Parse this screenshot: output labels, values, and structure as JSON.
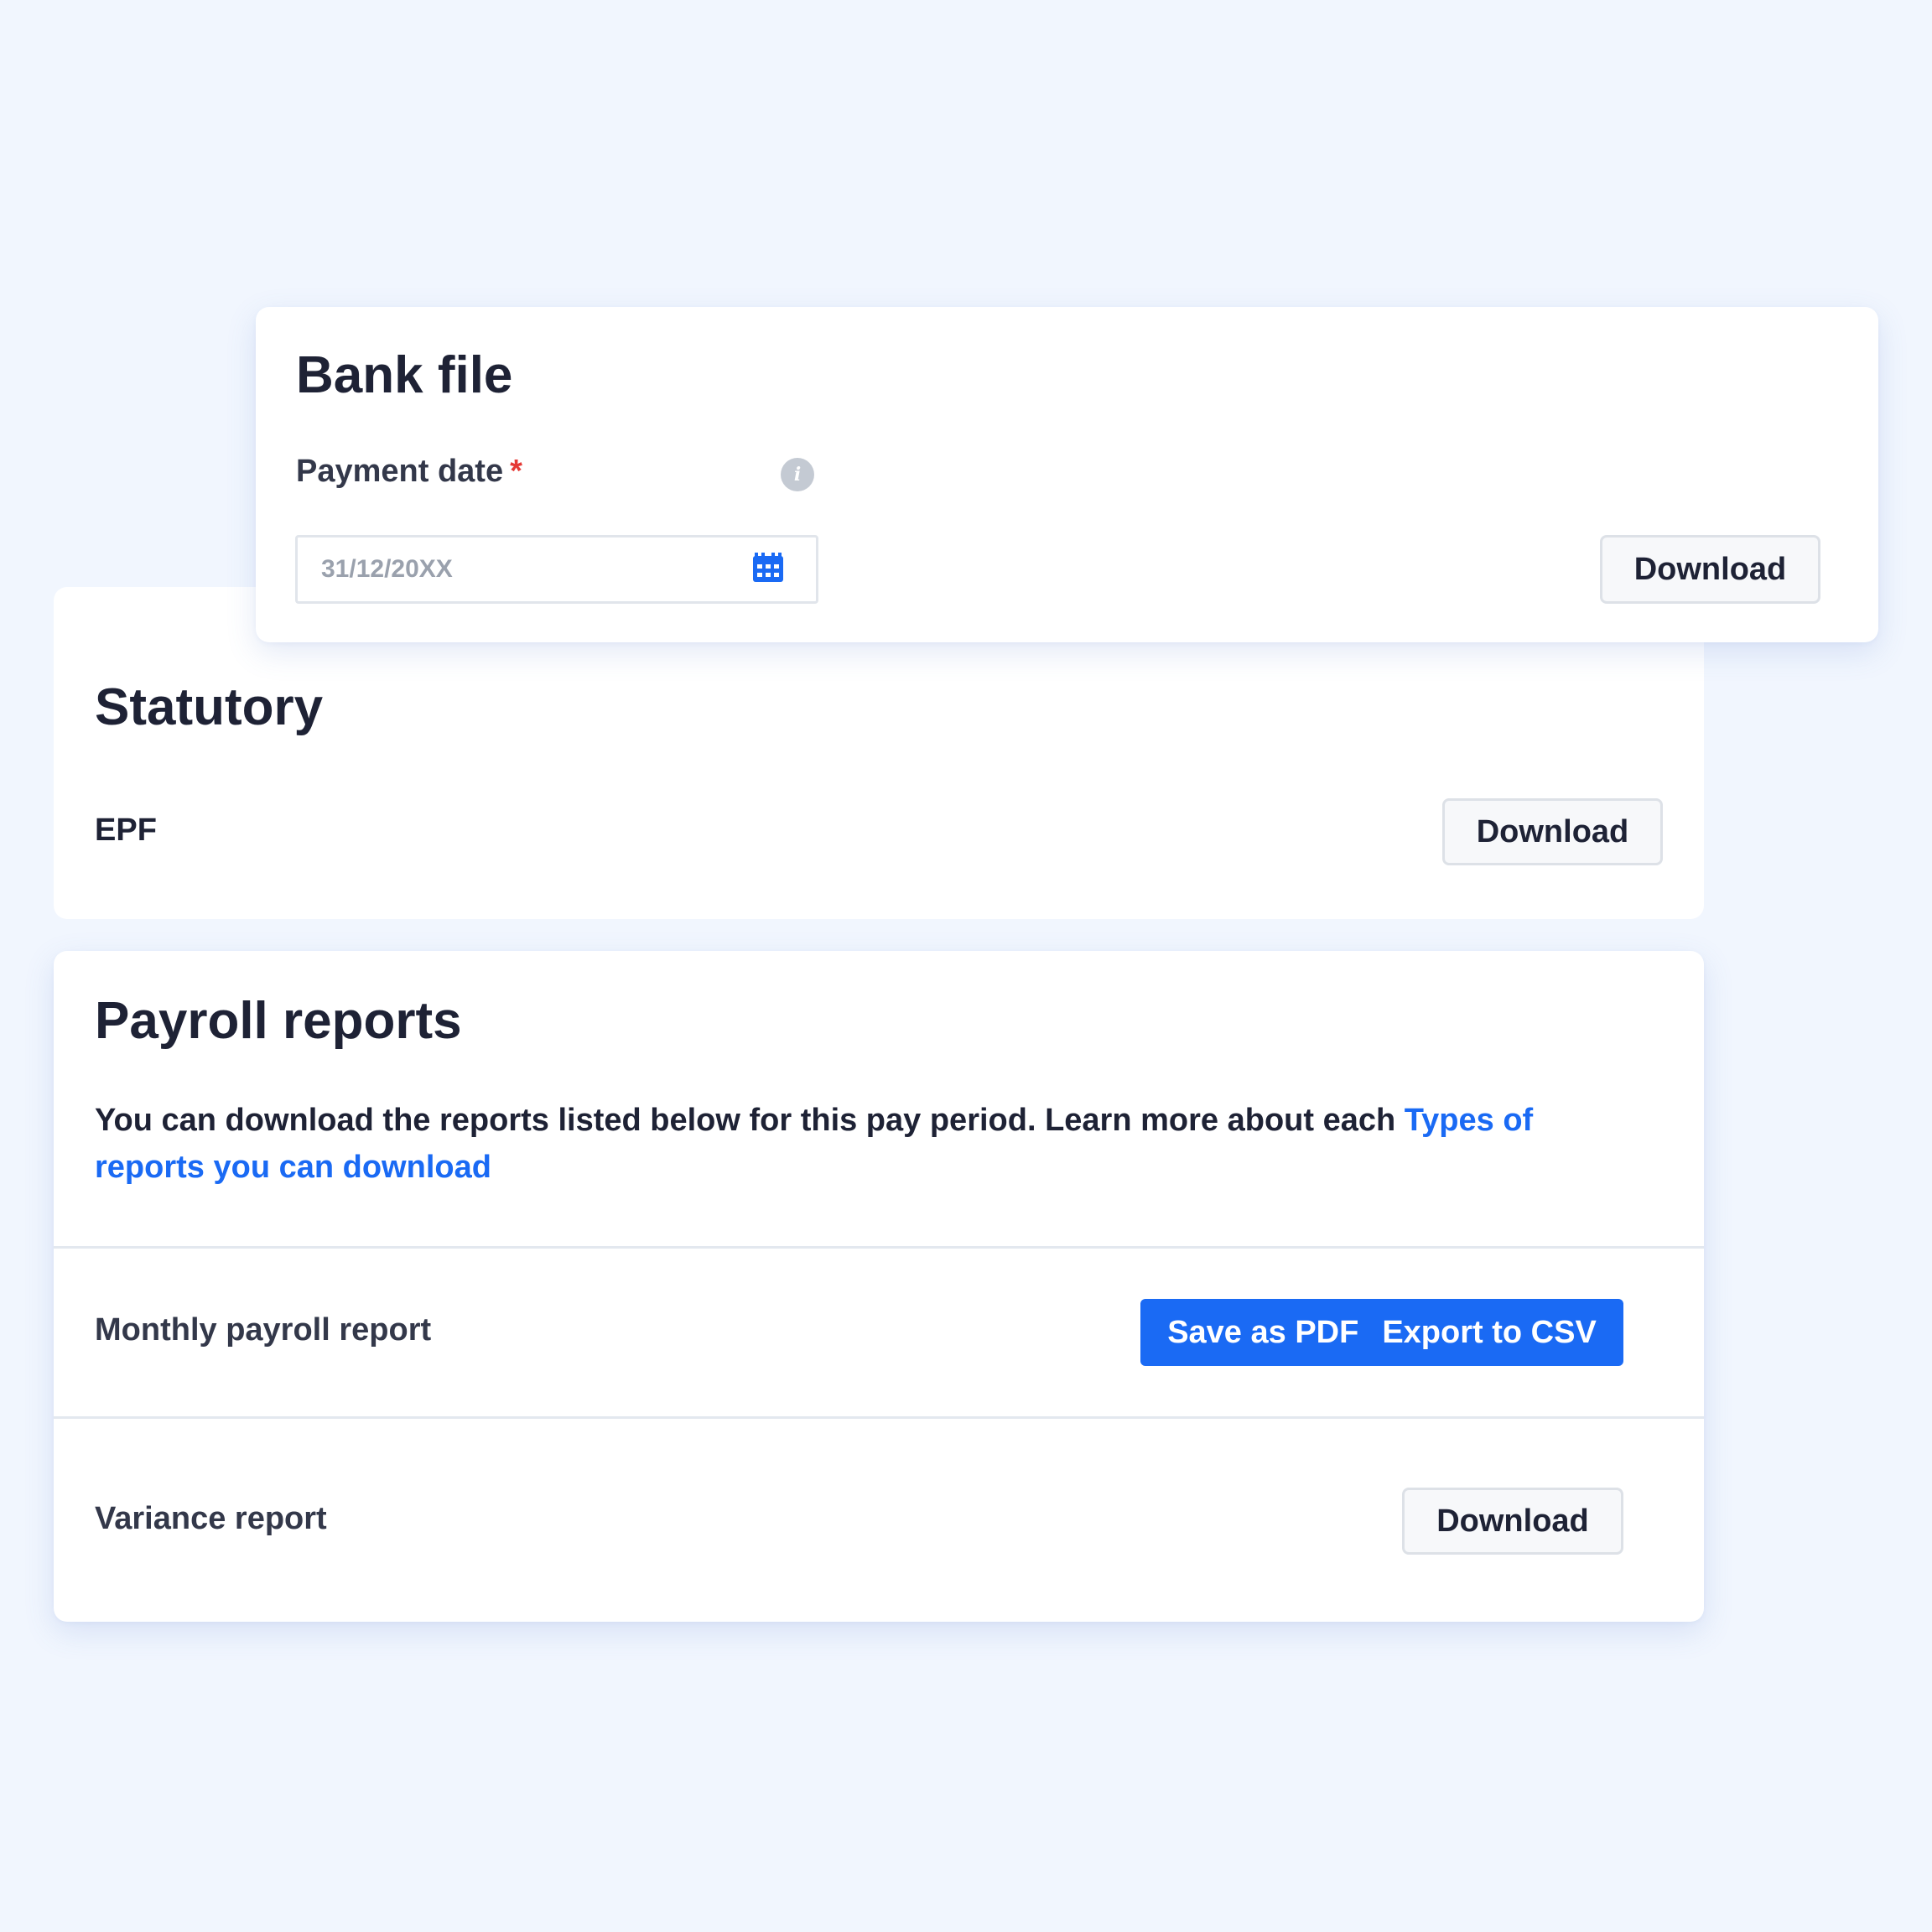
{
  "bank_file": {
    "title": "Bank file",
    "payment_date_label": "Payment date",
    "required_marker": "*",
    "info_icon": "info-icon",
    "date_placeholder": "31/12/20XX",
    "date_value": "",
    "calendar_icon": "calendar-icon",
    "download_label": "Download"
  },
  "statutory": {
    "title": "Statutory",
    "items": [
      {
        "label": "EPF",
        "download_label": "Download"
      }
    ]
  },
  "payroll_reports": {
    "title": "Payroll reports",
    "description": "You can download the reports listed below for this pay period. Learn more about each",
    "link_text": "Types of reports you can download",
    "reports": [
      {
        "label": "Monthly payroll report",
        "actions": [
          "Save as PDF",
          "Export to CSV"
        ]
      },
      {
        "label": "Variance report",
        "actions": [
          "Download"
        ]
      }
    ]
  },
  "colors": {
    "background": "#f1f6fe",
    "primary": "#1a6af4",
    "required": "#e53935",
    "text": "#1e2235"
  }
}
